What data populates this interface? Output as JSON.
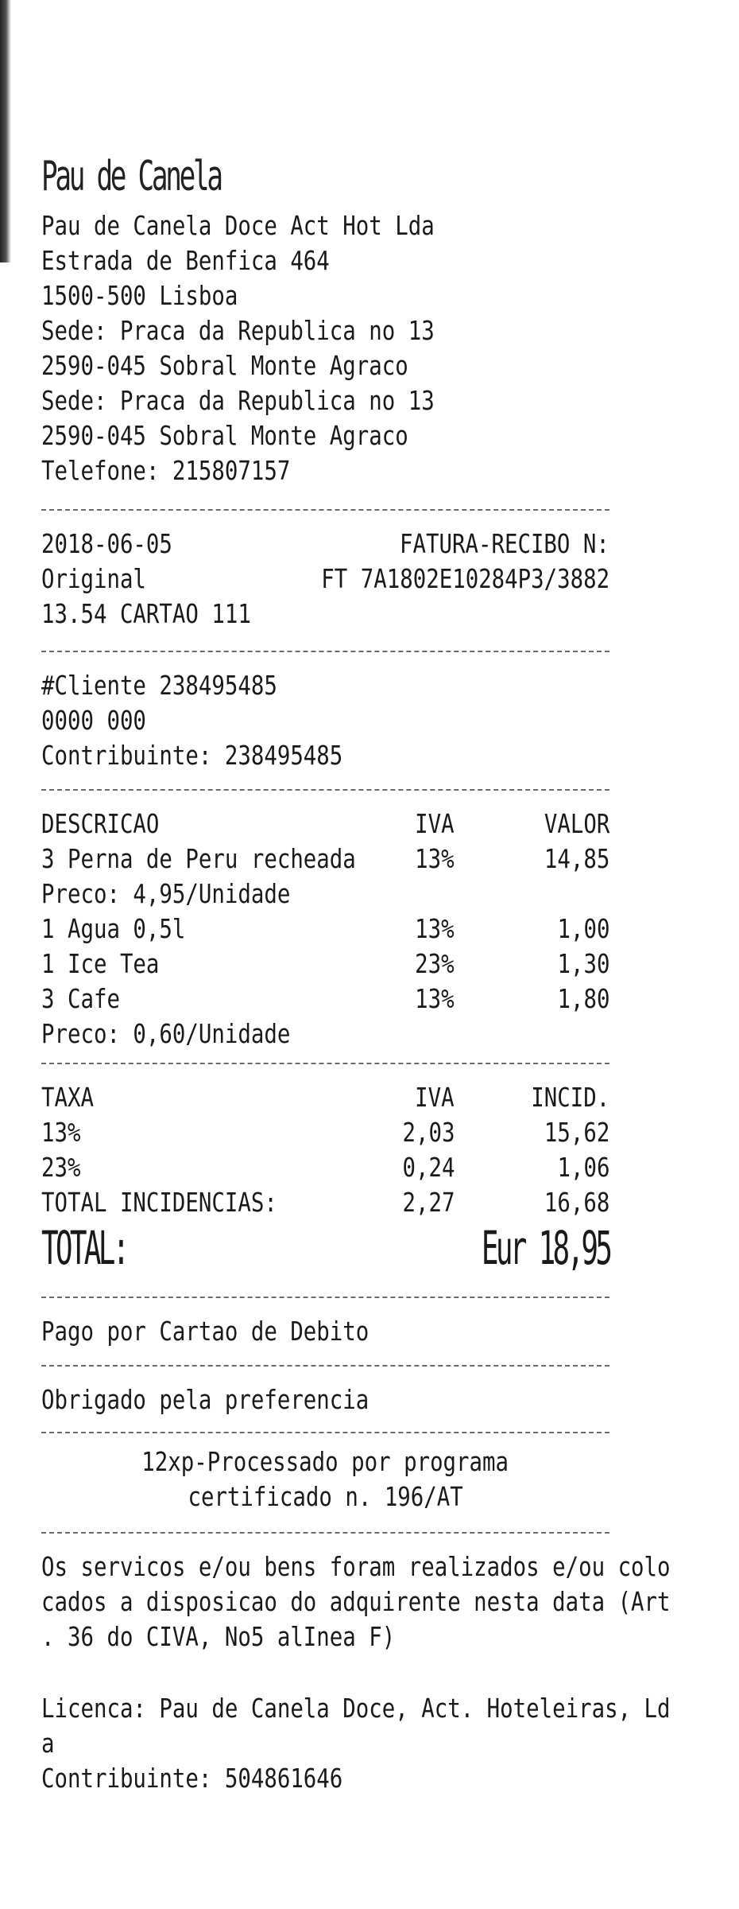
{
  "header": {
    "logo_text": "Pau de Canela",
    "lines": [
      "Pau de Canela Doce Act Hot Lda",
      "Estrada de Benfica 464",
      "1500-500 Lisboa",
      "Sede: Praca da Republica no 13",
      "2590-045 Sobral Monte Agraco",
      "Sede: Praca da Republica no 13",
      "2590-045 Sobral Monte Agraco",
      "Telefone: 215807157"
    ]
  },
  "document": {
    "date": "2018-06-05",
    "doc_type_label": "FATURA-RECIBO N:",
    "copy_type": "Original",
    "doc_number": "FT 7A1802E10284P3/3882",
    "time_payment": "13.54 CARTAO 111"
  },
  "customer": {
    "lines": [
      "#Cliente 238495485",
      "0000 000",
      "Contribuinte: 238495485"
    ]
  },
  "items": {
    "headers": {
      "description": "DESCRICAO",
      "vat": "IVA",
      "value": "VALOR"
    },
    "rows": [
      {
        "description": "3 Perna de Peru recheada",
        "vat": "13%",
        "value": "14,85",
        "price_note": " Preco: 4,95/Unidade"
      },
      {
        "description": "1 Agua 0,5l",
        "vat": "13%",
        "value": "1,00"
      },
      {
        "description": "1 Ice Tea",
        "vat": "23%",
        "value": "1,30"
      },
      {
        "description": "3 Cafe",
        "vat": "13%",
        "value": "1,80",
        "price_note": " Preco: 0,60/Unidade"
      }
    ]
  },
  "taxes": {
    "headers": {
      "rate": "TAXA",
      "vat": "IVA",
      "incidence": "INCID."
    },
    "rows": [
      {
        "rate": "13%",
        "vat": "2,03",
        "incidence": "15,62"
      },
      {
        "rate": "23%",
        "vat": "0,24",
        "incidence": "1,06"
      },
      {
        "rate": "TOTAL INCIDENCIAS:",
        "vat": "2,27",
        "incidence": "16,68"
      }
    ]
  },
  "total": {
    "label": "TOTAL:",
    "value": "Eur 18,95"
  },
  "payment": "Pago por Cartao de Debito",
  "thanks": "Obrigado pela preferencia",
  "certification": [
    "12xp-Processado por programa",
    "certificado n. 196/AT"
  ],
  "legal": [
    "Os servicos e/ou bens foram realizados e/ou colo",
    "cados a disposicao do adquirente nesta data (Art",
    ". 36 do CIVA, No5 alInea F)"
  ],
  "license": [
    "Licenca: Pau de Canela Doce, Act. Hoteleiras, Ld",
    "a",
    "Contribuinte: 504861646"
  ]
}
